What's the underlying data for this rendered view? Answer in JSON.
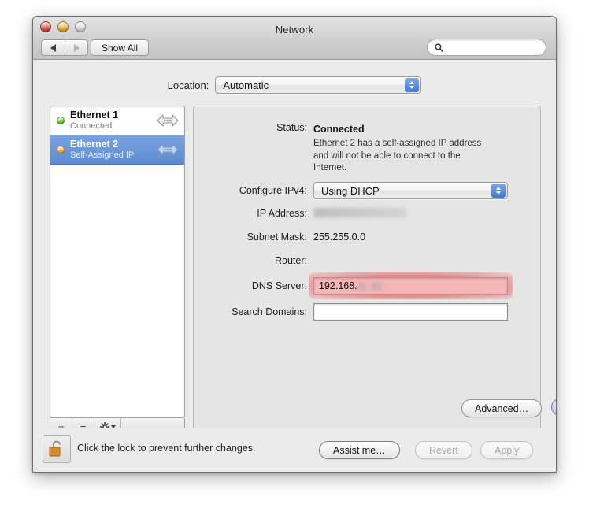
{
  "window": {
    "title": "Network",
    "traffic_lights": [
      "close",
      "minimize",
      "zoom"
    ]
  },
  "toolbar": {
    "back_label": "◀",
    "forward_label": "▶",
    "show_all_label": "Show All",
    "search_placeholder": "",
    "search_value": "",
    "search_icon": "search-icon"
  },
  "location": {
    "label": "Location:",
    "value": "Automatic"
  },
  "services": [
    {
      "name": "Ethernet 1",
      "status": "Connected",
      "indicator_color": "#43b61f",
      "selected": false,
      "icon": "ethernet-icon"
    },
    {
      "name": "Ethernet 2",
      "status": "Self-Assigned IP",
      "indicator_color": "#f0951a",
      "selected": true,
      "icon": "ethernet-icon"
    }
  ],
  "sidebar_footer": {
    "add_label": "+",
    "remove_label": "−",
    "action_label": "⚙"
  },
  "detail": {
    "status_label": "Status:",
    "status_value": "Connected",
    "status_description": "Ethernet 2 has a self-assigned IP address and will not be able to connect to the Internet.",
    "configure_ipv4_label": "Configure IPv4:",
    "configure_ipv4_value": "Using DHCP",
    "ip_address_label": "IP Address:",
    "ip_address_value": "",
    "ip_address_redacted": true,
    "subnet_mask_label": "Subnet Mask:",
    "subnet_mask_value": "255.255.0.0",
    "router_label": "Router:",
    "router_value": "",
    "dns_server_label": "DNS Server:",
    "dns_server_value": "192.168.",
    "dns_server_redacted": true,
    "dns_server_highlight_color": "#f4b6b7",
    "dns_server_glow_color": "#e26868",
    "search_domains_label": "Search Domains:",
    "search_domains_value": "",
    "advanced_label": "Advanced…",
    "help_label": "?"
  },
  "footer": {
    "lock_icon": "unlocked-padlock-icon",
    "lock_text": "Click the lock to prevent further changes.",
    "assist_label": "Assist me…",
    "revert_label": "Revert",
    "apply_label": "Apply",
    "revert_enabled": false,
    "apply_enabled": false
  }
}
